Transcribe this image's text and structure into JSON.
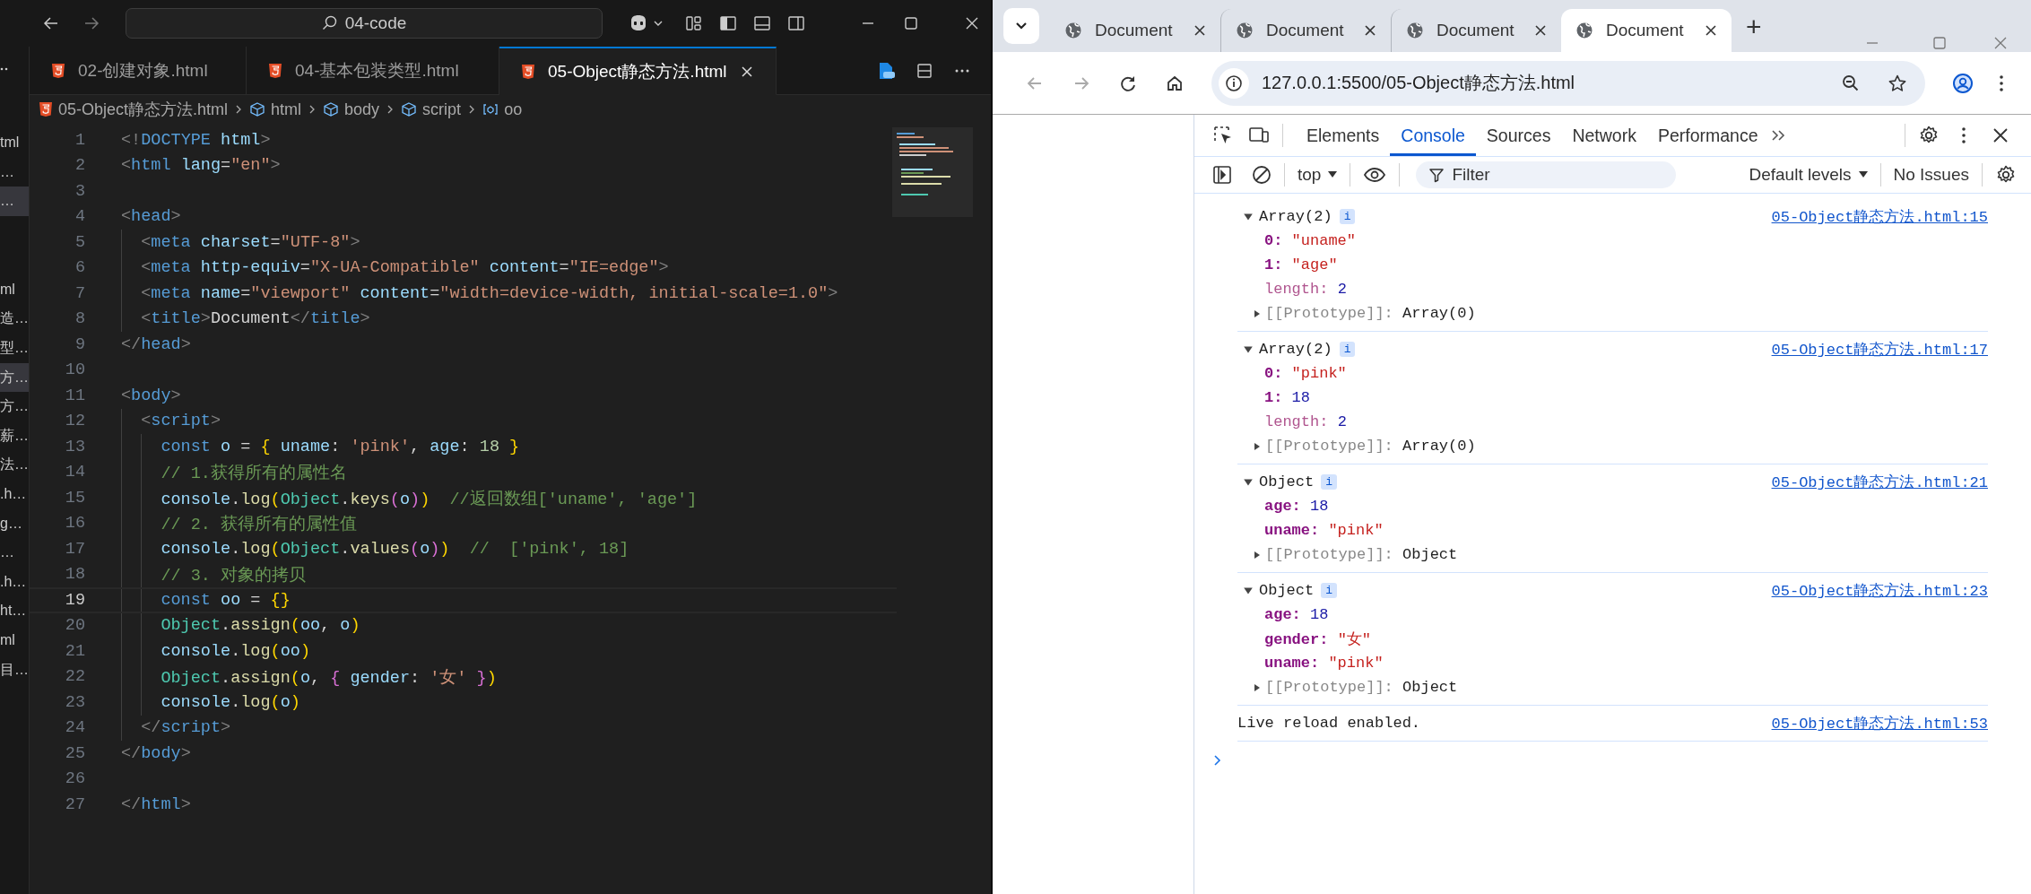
{
  "editor_window": {
    "search": "04-code",
    "sidebar": {
      "groups": [
        {
          "items": [
            {
              "label": "tml",
              "selected": false
            },
            {
              "label": "…",
              "selected": false
            },
            {
              "label": "…",
              "selected": true
            }
          ]
        },
        {
          "items": [
            {
              "label": "ml",
              "selected": false
            },
            {
              "label": "造…",
              "selected": false
            },
            {
              "label": "型…",
              "selected": false
            },
            {
              "label": "方…",
              "selected": true
            },
            {
              "label": "方…",
              "selected": false
            },
            {
              "label": "薪…",
              "selected": false
            },
            {
              "label": "法…",
              "selected": false
            },
            {
              "label": ".h…",
              "selected": false
            },
            {
              "label": "g…",
              "selected": false
            },
            {
              "label": "…",
              "selected": false
            },
            {
              "label": ".h…",
              "selected": false
            },
            {
              "label": "ht…",
              "selected": false
            },
            {
              "label": "ml",
              "selected": false
            },
            {
              "label": "目…",
              "selected": false
            }
          ]
        }
      ]
    },
    "tabs": [
      {
        "label": "02-创建对象.html",
        "selected": false
      },
      {
        "label": "04-基本包装类型.html",
        "selected": false
      },
      {
        "label": "05-Object静态方法.html",
        "selected": true
      }
    ],
    "breadcrumbs": [
      {
        "kind": "file",
        "label": "05-Object静态方法.html"
      },
      {
        "kind": "element",
        "label": "html"
      },
      {
        "kind": "element",
        "label": "body"
      },
      {
        "kind": "element",
        "label": "script"
      },
      {
        "kind": "variable",
        "label": "oo"
      }
    ],
    "lines": [
      {
        "number": "1",
        "current": false,
        "tokens": [
          {
            "kind": "punct",
            "text": "<!"
          },
          {
            "kind": "tag",
            "text": "DOCTYPE"
          },
          {
            "kind": "attr",
            "text": " html"
          },
          {
            "kind": "punct",
            "text": ">"
          }
        ]
      },
      {
        "number": "2",
        "current": false,
        "tokens": [
          {
            "kind": "punct",
            "text": "<"
          },
          {
            "kind": "tag",
            "text": "html"
          },
          {
            "kind": "attr",
            "text": " lang"
          },
          {
            "kind": "plain",
            "text": "="
          },
          {
            "kind": "string",
            "text": "\"en\""
          },
          {
            "kind": "punct",
            "text": ">"
          }
        ]
      },
      {
        "number": "3",
        "current": false
      },
      {
        "number": "4",
        "current": false,
        "tokens": [
          {
            "kind": "punct",
            "text": "<"
          },
          {
            "kind": "tag",
            "text": "head"
          },
          {
            "kind": "punct",
            "text": ">"
          }
        ]
      },
      {
        "number": "5",
        "current": false,
        "tokens": [
          {
            "kind": "punct",
            "text": "  <"
          },
          {
            "kind": "tag",
            "text": "meta"
          },
          {
            "kind": "attr",
            "text": " charset"
          },
          {
            "kind": "plain",
            "text": "="
          },
          {
            "kind": "string",
            "text": "\"UTF-8\""
          },
          {
            "kind": "punct",
            "text": ">"
          }
        ]
      },
      {
        "number": "6",
        "current": false,
        "tokens": [
          {
            "kind": "punct",
            "text": "  <"
          },
          {
            "kind": "tag",
            "text": "meta"
          },
          {
            "kind": "attr",
            "text": " http-equiv"
          },
          {
            "kind": "plain",
            "text": "="
          },
          {
            "kind": "string",
            "text": "\"X-UA-Compatible\""
          },
          {
            "kind": "attr",
            "text": " content"
          },
          {
            "kind": "plain",
            "text": "="
          },
          {
            "kind": "string",
            "text": "\"IE=edge\""
          },
          {
            "kind": "punct",
            "text": ">"
          }
        ]
      },
      {
        "number": "7",
        "current": false,
        "tokens": [
          {
            "kind": "punct",
            "text": "  <"
          },
          {
            "kind": "tag",
            "text": "meta"
          },
          {
            "kind": "attr",
            "text": " name"
          },
          {
            "kind": "plain",
            "text": "="
          },
          {
            "kind": "string",
            "text": "\"viewport\""
          },
          {
            "kind": "attr",
            "text": " content"
          },
          {
            "kind": "plain",
            "text": "="
          },
          {
            "kind": "string",
            "text": "\"width=device-width, initial-scale=1.0\""
          },
          {
            "kind": "punct",
            "text": ">"
          }
        ]
      },
      {
        "number": "8",
        "current": false,
        "tokens": [
          {
            "kind": "punct",
            "text": "  <"
          },
          {
            "kind": "tag",
            "text": "title"
          },
          {
            "kind": "punct",
            "text": ">"
          },
          {
            "kind": "plain",
            "text": "Document"
          },
          {
            "kind": "punct",
            "text": "</"
          },
          {
            "kind": "tag",
            "text": "title"
          },
          {
            "kind": "punct",
            "text": ">"
          }
        ]
      },
      {
        "number": "9",
        "current": false,
        "tokens": [
          {
            "kind": "punct",
            "text": "</"
          },
          {
            "kind": "tag",
            "text": "head"
          },
          {
            "kind": "punct",
            "text": ">"
          }
        ]
      },
      {
        "number": "10",
        "current": false
      },
      {
        "number": "11",
        "current": false,
        "tokens": [
          {
            "kind": "punct",
            "text": "<"
          },
          {
            "kind": "tag",
            "text": "body"
          },
          {
            "kind": "punct",
            "text": ">"
          }
        ]
      },
      {
        "number": "12",
        "current": false,
        "tokens": [
          {
            "kind": "punct",
            "text": "  <"
          },
          {
            "kind": "tag",
            "text": "script"
          },
          {
            "kind": "punct",
            "text": ">"
          }
        ]
      },
      {
        "number": "13",
        "current": false,
        "tokens": [
          {
            "kind": "keyword",
            "text": "    const"
          },
          {
            "kind": "variable",
            "text": " o"
          },
          {
            "kind": "plain",
            "text": " = "
          },
          {
            "kind": "bracket1",
            "text": "{"
          },
          {
            "kind": "property",
            "text": " uname"
          },
          {
            "kind": "plain",
            "text": ": "
          },
          {
            "kind": "string",
            "text": "'pink'"
          },
          {
            "kind": "plain",
            "text": ", "
          },
          {
            "kind": "property",
            "text": "age"
          },
          {
            "kind": "plain",
            "text": ": "
          },
          {
            "kind": "number",
            "text": "18"
          },
          {
            "kind": "bracket1",
            "text": " }"
          }
        ]
      },
      {
        "number": "14",
        "current": false,
        "tokens": [
          {
            "kind": "comment",
            "text": "    // 1.获得所有的属性名"
          }
        ]
      },
      {
        "number": "15",
        "current": false,
        "tokens": [
          {
            "kind": "variable",
            "text": "    console"
          },
          {
            "kind": "plain",
            "text": "."
          },
          {
            "kind": "function",
            "text": "log"
          },
          {
            "kind": "bracket1",
            "text": "("
          },
          {
            "kind": "class",
            "text": "Object"
          },
          {
            "kind": "plain",
            "text": "."
          },
          {
            "kind": "function",
            "text": "keys"
          },
          {
            "kind": "bracket2",
            "text": "("
          },
          {
            "kind": "variable",
            "text": "o"
          },
          {
            "kind": "bracket2",
            "text": ")"
          },
          {
            "kind": "bracket1",
            "text": ")"
          },
          {
            "kind": "comment",
            "text": "  //返回数组['uname', 'age']"
          }
        ]
      },
      {
        "number": "16",
        "current": false,
        "tokens": [
          {
            "kind": "comment",
            "text": "    // 2. 获得所有的属性值"
          }
        ]
      },
      {
        "number": "17",
        "current": false,
        "tokens": [
          {
            "kind": "variable",
            "text": "    console"
          },
          {
            "kind": "plain",
            "text": "."
          },
          {
            "kind": "function",
            "text": "log"
          },
          {
            "kind": "bracket1",
            "text": "("
          },
          {
            "kind": "class",
            "text": "Object"
          },
          {
            "kind": "plain",
            "text": "."
          },
          {
            "kind": "function",
            "text": "values"
          },
          {
            "kind": "bracket2",
            "text": "("
          },
          {
            "kind": "variable",
            "text": "o"
          },
          {
            "kind": "bracket2",
            "text": ")"
          },
          {
            "kind": "bracket1",
            "text": ")"
          },
          {
            "kind": "comment",
            "text": "  //  ['pink', 18]"
          }
        ]
      },
      {
        "number": "18",
        "current": false,
        "tokens": [
          {
            "kind": "comment",
            "text": "    // 3. 对象的拷贝"
          }
        ]
      },
      {
        "number": "19",
        "current": true,
        "tokens": [
          {
            "kind": "keyword",
            "text": "    const"
          },
          {
            "kind": "variable",
            "text": " oo"
          },
          {
            "kind": "plain",
            "text": " = "
          },
          {
            "kind": "bracket1",
            "text": "{}"
          }
        ]
      },
      {
        "number": "20",
        "current": false,
        "tokens": [
          {
            "kind": "class",
            "text": "    Object"
          },
          {
            "kind": "plain",
            "text": "."
          },
          {
            "kind": "function",
            "text": "assign"
          },
          {
            "kind": "bracket1",
            "text": "("
          },
          {
            "kind": "variable",
            "text": "oo"
          },
          {
            "kind": "plain",
            "text": ", "
          },
          {
            "kind": "variable",
            "text": "o"
          },
          {
            "kind": "bracket1",
            "text": ")"
          }
        ]
      },
      {
        "number": "21",
        "current": false,
        "tokens": [
          {
            "kind": "variable",
            "text": "    console"
          },
          {
            "kind": "plain",
            "text": "."
          },
          {
            "kind": "function",
            "text": "log"
          },
          {
            "kind": "bracket1",
            "text": "("
          },
          {
            "kind": "variable",
            "text": "oo"
          },
          {
            "kind": "bracket1",
            "text": ")"
          }
        ]
      },
      {
        "number": "22",
        "current": false,
        "tokens": [
          {
            "kind": "class",
            "text": "    Object"
          },
          {
            "kind": "plain",
            "text": "."
          },
          {
            "kind": "function",
            "text": "assign"
          },
          {
            "kind": "bracket1",
            "text": "("
          },
          {
            "kind": "variable",
            "text": "o"
          },
          {
            "kind": "plain",
            "text": ", "
          },
          {
            "kind": "bracket2",
            "text": "{"
          },
          {
            "kind": "property",
            "text": " gender"
          },
          {
            "kind": "plain",
            "text": ": "
          },
          {
            "kind": "string",
            "text": "'女'"
          },
          {
            "kind": "bracket2",
            "text": " }"
          },
          {
            "kind": "bracket1",
            "text": ")"
          }
        ]
      },
      {
        "number": "23",
        "current": false,
        "tokens": [
          {
            "kind": "variable",
            "text": "    console"
          },
          {
            "kind": "plain",
            "text": "."
          },
          {
            "kind": "function",
            "text": "log"
          },
          {
            "kind": "bracket1",
            "text": "("
          },
          {
            "kind": "variable",
            "text": "o"
          },
          {
            "kind": "bracket1",
            "text": ")"
          }
        ]
      },
      {
        "number": "24",
        "current": false,
        "tokens": [
          {
            "kind": "punct",
            "text": "  </"
          },
          {
            "kind": "tag",
            "text": "script"
          },
          {
            "kind": "punct",
            "text": ">"
          }
        ]
      },
      {
        "number": "25",
        "current": false,
        "tokens": [
          {
            "kind": "punct",
            "text": "</"
          },
          {
            "kind": "tag",
            "text": "body"
          },
          {
            "kind": "punct",
            "text": ">"
          }
        ]
      },
      {
        "number": "26",
        "current": false
      },
      {
        "number": "27",
        "current": false,
        "tokens": [
          {
            "kind": "punct",
            "text": "</"
          },
          {
            "kind": "tag",
            "text": "html"
          },
          {
            "kind": "punct",
            "text": ">"
          }
        ]
      }
    ]
  },
  "browser": {
    "tabs": [
      {
        "label": "Document",
        "selected": false
      },
      {
        "label": "Document",
        "selected": false
      },
      {
        "label": "Document",
        "selected": false
      },
      {
        "label": "Document",
        "selected": true
      }
    ],
    "new_tab": "+",
    "address": "127.0.0.1:5500/05-Object静态方法.html",
    "devtools": {
      "tabs": [
        {
          "label": "Elements",
          "selected": false
        },
        {
          "label": "Console",
          "selected": true
        },
        {
          "label": "Sources",
          "selected": false
        },
        {
          "label": "Network",
          "selected": false
        },
        {
          "label": "Performance",
          "selected": false
        }
      ],
      "context": "top",
      "filter_placeholder": "Filter",
      "levels": "Default levels",
      "issues": "No Issues",
      "messages": [
        {
          "kind": "object",
          "summary": "Array(2)",
          "badge": "i",
          "expanded": true,
          "source": "05-Object静态方法.html:15",
          "rows": [
            {
              "kind": "prop",
              "key": {
                "kind": "own",
                "text": "0:"
              },
              "value": {
                "kind": "string",
                "text": "\"uname\""
              }
            },
            {
              "kind": "prop",
              "key": {
                "kind": "own",
                "text": "1:"
              },
              "value": {
                "kind": "string",
                "text": "\"age\""
              }
            },
            {
              "kind": "prop",
              "key": {
                "kind": "internal",
                "text": "length:"
              },
              "value": {
                "kind": "number",
                "text": "2"
              }
            },
            {
              "kind": "proto",
              "key": "[[Prototype]]:",
              "value": "Array(0)",
              "expanded": false
            }
          ]
        },
        {
          "kind": "object",
          "summary": "Array(2)",
          "badge": "i",
          "expanded": true,
          "source": "05-Object静态方法.html:17",
          "rows": [
            {
              "kind": "prop",
              "key": {
                "kind": "own",
                "text": "0:"
              },
              "value": {
                "kind": "string",
                "text": "\"pink\""
              }
            },
            {
              "kind": "prop",
              "key": {
                "kind": "own",
                "text": "1:"
              },
              "value": {
                "kind": "number",
                "text": "18"
              }
            },
            {
              "kind": "prop",
              "key": {
                "kind": "internal",
                "text": "length:"
              },
              "value": {
                "kind": "number",
                "text": "2"
              }
            },
            {
              "kind": "proto",
              "key": "[[Prototype]]:",
              "value": "Array(0)",
              "expanded": false
            }
          ]
        },
        {
          "kind": "object",
          "summary": "Object",
          "badge": "i",
          "expanded": true,
          "source": "05-Object静态方法.html:21",
          "rows": [
            {
              "kind": "prop",
              "key": {
                "kind": "own",
                "text": "age:"
              },
              "value": {
                "kind": "number",
                "text": "18"
              }
            },
            {
              "kind": "prop",
              "key": {
                "kind": "own",
                "text": "uname:"
              },
              "value": {
                "kind": "string",
                "text": "\"pink\""
              }
            },
            {
              "kind": "proto",
              "key": "[[Prototype]]:",
              "value": "Object",
              "expanded": false
            }
          ]
        },
        {
          "kind": "object",
          "summary": "Object",
          "badge": "i",
          "expanded": true,
          "source": "05-Object静态方法.html:23",
          "rows": [
            {
              "kind": "prop",
              "key": {
                "kind": "own",
                "text": "age:"
              },
              "value": {
                "kind": "number",
                "text": "18"
              }
            },
            {
              "kind": "prop",
              "key": {
                "kind": "own",
                "text": "gender:"
              },
              "value": {
                "kind": "string",
                "text": "\"女\""
              }
            },
            {
              "kind": "prop",
              "key": {
                "kind": "own",
                "text": "uname:"
              },
              "value": {
                "kind": "string",
                "text": "\"pink\""
              }
            },
            {
              "kind": "proto",
              "key": "[[Prototype]]:",
              "value": "Object",
              "expanded": false
            }
          ]
        },
        {
          "kind": "log",
          "text": "Live reload enabled.",
          "source": "05-Object静态方法.html:53"
        }
      ]
    }
  }
}
